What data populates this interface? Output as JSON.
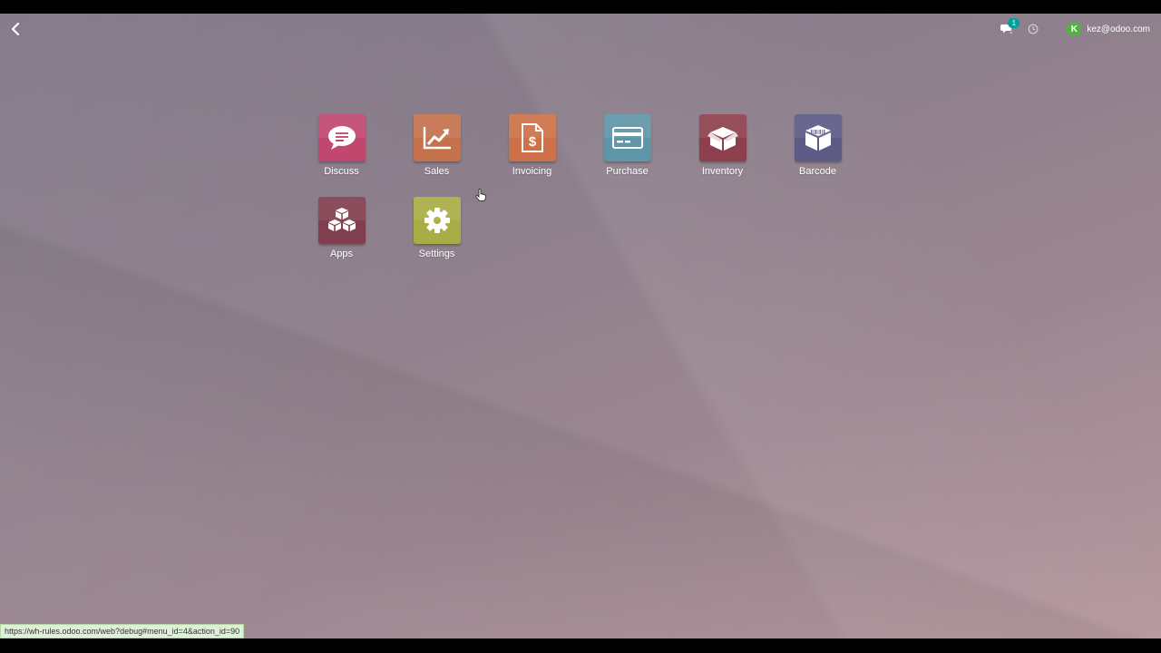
{
  "topbar": {
    "back_icon": "chevron-left-icon",
    "chat_icon": "chat-icon",
    "chat_badge": "1",
    "clock_icon": "clock-icon",
    "avatar_letter": "K",
    "user_email": "kez@odoo.com"
  },
  "apps": [
    {
      "label": "Discuss",
      "icon": "chat-bubble-icon",
      "color": "#c2476f"
    },
    {
      "label": "Sales",
      "icon": "trend-chart-icon",
      "color": "#c4714c"
    },
    {
      "label": "Invoicing",
      "icon": "invoice-dollar-icon",
      "color": "#cf7148"
    },
    {
      "label": "Purchase",
      "icon": "credit-card-icon",
      "color": "#5f95a8"
    },
    {
      "label": "Inventory",
      "icon": "box-icon",
      "color": "#8d3f4d"
    },
    {
      "label": "Barcode",
      "icon": "barcode-box-icon",
      "color": "#5c5b86"
    },
    {
      "label": "Apps",
      "icon": "cubes-icon",
      "color": "#813e4f"
    },
    {
      "label": "Settings",
      "icon": "gear-icon",
      "color": "#a9ad45"
    }
  ],
  "status_url": "https://wh-rules.odoo.com/web?debug#menu_id=4&action_id=90"
}
